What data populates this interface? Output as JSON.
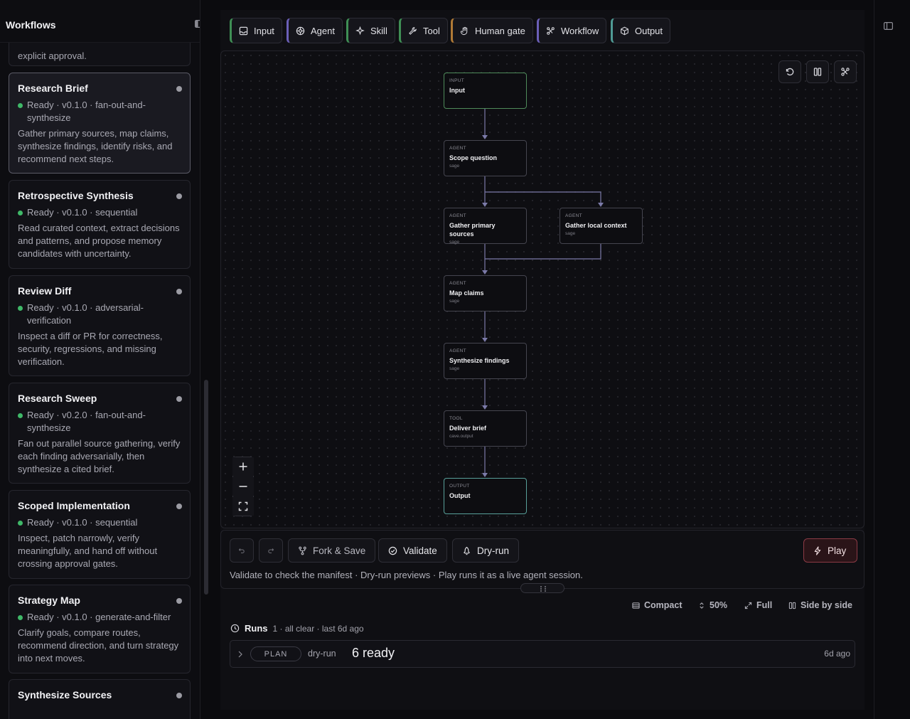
{
  "sidebar": {
    "title": "Workflows",
    "truncated_prev_tail": "explicit approval.",
    "items": [
      {
        "title": "Research Brief",
        "meta": "Ready · v0.1.0 · fan-out-and-synthesize",
        "desc": "Gather primary sources, map claims, synthesize findings, identify risks, and recommend next steps.",
        "active": true
      },
      {
        "title": "Retrospective Synthesis",
        "meta": "Ready · v0.1.0 · sequential",
        "desc": "Read curated context, extract decisions and patterns, and propose memory candidates with uncertainty."
      },
      {
        "title": "Review Diff",
        "meta": "Ready · v0.1.0 · adversarial-verification",
        "desc": "Inspect a diff or PR for correctness, security, regressions, and missing verification."
      },
      {
        "title": "Research Sweep",
        "meta": "Ready · v0.2.0 · fan-out-and-synthesize",
        "desc": "Fan out parallel source gathering, verify each finding adversarially, then synthesize a cited brief."
      },
      {
        "title": "Scoped Implementation",
        "meta": "Ready · v0.1.0 · sequential",
        "desc": "Inspect, patch narrowly, verify meaningfully, and hand off without crossing approval gates."
      },
      {
        "title": "Strategy Map",
        "meta": "Ready · v0.1.0 · generate-and-filter",
        "desc": "Clarify goals, compare routes, recommend direction, and turn strategy into next moves."
      },
      {
        "title": "Synthesize Sources",
        "meta": "",
        "desc": ""
      }
    ]
  },
  "palette": [
    {
      "label": "Input",
      "icon": "inbox-icon",
      "accent": "#3f8f55"
    },
    {
      "label": "Agent",
      "icon": "agent-icon",
      "accent": "#6b5fb8"
    },
    {
      "label": "Skill",
      "icon": "sparkle-icon",
      "accent": "#3f8f55"
    },
    {
      "label": "Tool",
      "icon": "wrench-icon",
      "accent": "#3f8f55"
    },
    {
      "label": "Human gate",
      "icon": "hand-icon",
      "accent": "#b07a36"
    },
    {
      "label": "Workflow",
      "icon": "workflow-icon",
      "accent": "#6b5fb8"
    },
    {
      "label": "Output",
      "icon": "package-icon",
      "accent": "#4f9a94"
    }
  ],
  "nodes": [
    {
      "id": "input",
      "kind": "INPUT",
      "label": "Input",
      "sub": ""
    },
    {
      "id": "scope",
      "kind": "AGENT",
      "label": "Scope question",
      "sub": "sage"
    },
    {
      "id": "primary",
      "kind": "AGENT",
      "label": "Gather primary sources",
      "sub": "sage"
    },
    {
      "id": "local",
      "kind": "AGENT",
      "label": "Gather local context",
      "sub": "sage"
    },
    {
      "id": "map",
      "kind": "AGENT",
      "label": "Map claims",
      "sub": "sage"
    },
    {
      "id": "synth",
      "kind": "AGENT",
      "label": "Synthesize findings",
      "sub": "sage"
    },
    {
      "id": "deliver",
      "kind": "TOOL",
      "label": "Deliver brief",
      "sub": "cave.output"
    },
    {
      "id": "output",
      "kind": "OUTPUT",
      "label": "Output",
      "sub": ""
    }
  ],
  "actions": {
    "fork_label": "Fork & Save",
    "validate_label": "Validate",
    "dryrun_label": "Dry-run",
    "play_label": "Play",
    "hint": "Validate to check the manifest · Dry-run previews · Play runs it as a live agent session."
  },
  "view_modes": {
    "compact": "Compact",
    "half": "50%",
    "full": "Full",
    "side": "Side by side"
  },
  "runs": {
    "title": "Runs",
    "meta": "1 · all clear · last 6d ago",
    "rows": [
      {
        "badge": "PLAN",
        "kind": "dry-run",
        "status": "6 ready",
        "time": "6d ago"
      }
    ]
  }
}
